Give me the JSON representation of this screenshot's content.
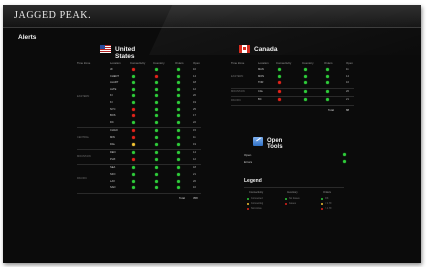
{
  "app": {
    "brand": "JAGGED PEAK."
  },
  "page": {
    "title": "Alerts"
  },
  "colors": {
    "green": "#2ecc3a",
    "red": "#e2231a",
    "yellow": "#f1c232"
  },
  "columns": [
    "Time Zone",
    "Location",
    "Connectivity",
    "Inventory",
    "Orders",
    "Open"
  ],
  "us": {
    "title": "United States",
    "flag_icon": "us-flag-icon",
    "total_label": "Total",
    "total_value": "358",
    "groups": [
      {
        "zone": "EASTERN",
        "rows": [
          {
            "loc": "JF",
            "c": "r",
            "i": "g",
            "o": "g",
            "open": "10"
          },
          {
            "loc": "CHENT",
            "c": "g",
            "i": "r",
            "o": "g",
            "open": "14"
          },
          {
            "loc": "ALART",
            "c": "g",
            "i": "g",
            "o": "g",
            "open": "18"
          },
          {
            "loc": "ALTE",
            "c": "g",
            "i": "g",
            "o": "g",
            "open": "12"
          },
          {
            "loc": "KI",
            "c": "g",
            "i": "g",
            "o": "g",
            "open": "20"
          },
          {
            "loc": "KI",
            "c": "g",
            "i": "g",
            "o": "g",
            "open": "19"
          },
          {
            "loc": "NYC",
            "c": "r",
            "i": "g",
            "o": "g",
            "open": "25"
          },
          {
            "loc": "BOS",
            "c": "r",
            "i": "g",
            "o": "g",
            "open": "17"
          },
          {
            "loc": "DC",
            "c": "g",
            "i": "g",
            "o": "g",
            "open": "22"
          }
        ]
      },
      {
        "zone": "CENTRAL",
        "rows": [
          {
            "loc": "CHGO",
            "c": "r",
            "i": "g",
            "o": "g",
            "open": "15"
          },
          {
            "loc": "MIN",
            "c": "r",
            "i": "g",
            "o": "g",
            "open": "11"
          },
          {
            "loc": "DAL",
            "c": "y",
            "i": "g",
            "o": "g",
            "open": "19"
          }
        ]
      },
      {
        "zone": "MOUNTAIN",
        "rows": [
          {
            "loc": "DEN",
            "c": "g",
            "i": "g",
            "o": "g",
            "open": "14"
          },
          {
            "loc": "PHX",
            "c": "r",
            "i": "g",
            "o": "g",
            "open": "12"
          }
        ]
      },
      {
        "zone": "PACIFIC",
        "rows": [
          {
            "loc": "SEA",
            "c": "g",
            "i": "g",
            "o": "g",
            "open": "18"
          },
          {
            "loc": "SFO",
            "c": "g",
            "i": "g",
            "o": "g",
            "open": "21"
          },
          {
            "loc": "LAX",
            "c": "g",
            "i": "g",
            "o": "g",
            "open": "26"
          },
          {
            "loc": "SAN",
            "c": "g",
            "i": "g",
            "o": "g",
            "open": "10"
          }
        ]
      }
    ]
  },
  "canada": {
    "title": "Canada",
    "flag_icon": "canada-flag-icon",
    "total_label": "Total",
    "total_value": "88",
    "groups": [
      {
        "zone": "EASTERN",
        "rows": [
          {
            "loc": "MAN",
            "c": "g",
            "i": "g",
            "o": "g",
            "open": "11"
          },
          {
            "loc": "MON",
            "c": "g",
            "i": "g",
            "o": "g",
            "open": "14"
          },
          {
            "loc": "TOR",
            "c": "r",
            "i": "g",
            "o": "g",
            "open": "16"
          }
        ]
      },
      {
        "zone": "MOUNTAIN",
        "rows": [
          {
            "loc": "CAL",
            "c": "r",
            "i": "g",
            "o": "g",
            "open": "26"
          }
        ]
      },
      {
        "zone": "PACIFIC",
        "rows": [
          {
            "loc": "BC",
            "c": "r",
            "i": "g",
            "o": "g",
            "open": "21"
          }
        ]
      }
    ]
  },
  "open_tools": {
    "title": "Open Tools",
    "icon": "tools-icon",
    "items": [
      {
        "label": "Open",
        "status": "g"
      },
      {
        "label": "Errors",
        "status": "g"
      }
    ]
  },
  "legend": {
    "title": "Legend",
    "columns": [
      {
        "header": "Connectivity",
        "items": [
          {
            "label": "Connected",
            "color": "g"
          },
          {
            "label": "Connecting",
            "color": "y"
          },
          {
            "label": "Not Active",
            "color": "r"
          }
        ]
      },
      {
        "header": "Inventory",
        "items": [
          {
            "label": "No Issues",
            "color": "g"
          },
          {
            "label": "Issues",
            "color": "r"
          }
        ]
      },
      {
        "header": "Orders",
        "items": [
          {
            "label": "OK",
            "color": "g"
          },
          {
            "label": "< 1 Hr",
            "color": "y"
          },
          {
            "label": "> 1 Hr",
            "color": "r"
          }
        ]
      }
    ]
  }
}
